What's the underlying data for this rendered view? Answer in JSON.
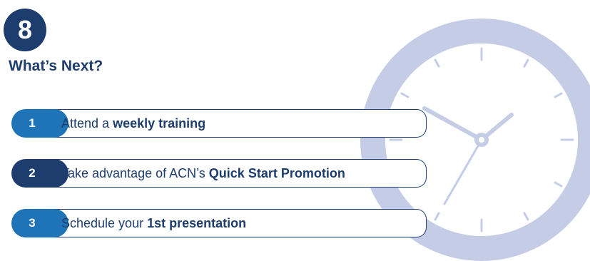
{
  "colors": {
    "navy": "#1d3d6e",
    "blue": "#1f73b7",
    "clock": "#c5cde6"
  },
  "step": {
    "number": "8"
  },
  "heading": "What’s Next?",
  "items": [
    {
      "number": "1",
      "text": "Attend a",
      "bold": "weekly training",
      "badge_color": "#1f73b7"
    },
    {
      "number": "2",
      "text": "Take advantage of ACN’s",
      "bold": "Quick Start Promotion",
      "badge_color": "#1d3d6e"
    },
    {
      "number": "3",
      "text": "Schedule your",
      "bold": "1st presentation",
      "badge_color": "#1f73b7"
    }
  ]
}
